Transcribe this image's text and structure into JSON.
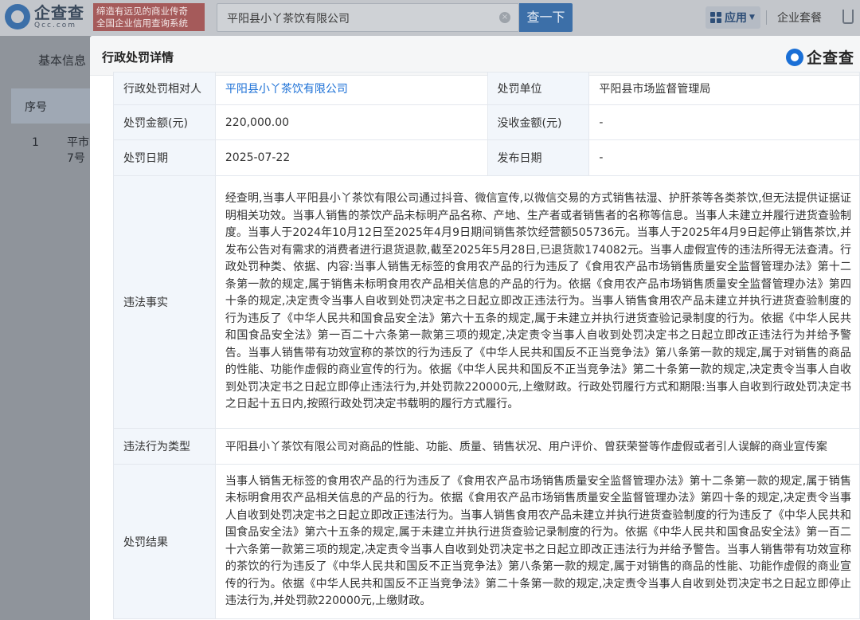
{
  "topbar": {
    "logo_cn": "企查查",
    "logo_en": "Qcc.com",
    "slogan_line1": "缔造有远见的商业传奇",
    "slogan_line2": "全国企业信用查询系统",
    "search_value": "平阳县小丫茶饮有限公司",
    "search_clear": "×",
    "search_button": "查一下",
    "apps_label": "应用",
    "suite_label": "企业套餐"
  },
  "background": {
    "tab_label": "基本信息",
    "table_header": "序号",
    "row_number": "1",
    "row_text_line1": "平市",
    "row_text_line2": "7号"
  },
  "modal": {
    "title": "行政处罚详情",
    "brand": "企查查",
    "rows": {
      "party_label": "行政处罚相对人",
      "party_value": "平阳县小丫茶饮有限公司",
      "unit_label": "处罚单位",
      "unit_value": "平阳县市场监督管理局",
      "amount_label": "处罚金额(元)",
      "amount_value": "220,000.00",
      "confiscated_label": "没收金额(元)",
      "confiscated_value": "-",
      "date_label": "处罚日期",
      "date_value": "2025-07-22",
      "publish_label": "发布日期",
      "publish_value": "-",
      "facts_label": "违法事实",
      "facts_value": "经查明,当事人平阳县小丫茶饮有限公司通过抖音、微信宣传,以微信交易的方式销售祛湿、护肝茶等各类茶饮,但无法提供证据证明相关功效。当事人销售的茶饮产品未标明产品名称、产地、生产者或者销售者的名称等信息。当事人未建立并履行进货查验制度。当事人于2024年10月12日至2025年4月9日期间销售茶饮经营额505736元。当事人于2025年4月9日起停止销售茶饮,并发布公告对有需求的消费者进行退货退款,截至2025年5月28日,已退货款174082元。当事人虚假宣传的违法所得无法查清。行政处罚种类、依据、内容:当事人销售无标签的食用农产品的行为违反了《食用农产品市场销售质量安全监督管理办法》第十二条第一款的规定,属于销售未标明食用农产品相关信息的产品的行为。依据《食用农产品市场销售质量安全监督管理办法》第四十条的规定,决定责令当事人自收到处罚决定书之日起立即改正违法行为。当事人销售食用农产品未建立并执行进货查验制度的行为违反了《中华人民共和国食品安全法》第六十五条的规定,属于未建立并执行进货查验记录制度的行为。依据《中华人民共和国食品安全法》第一百二十六条第一款第三项的规定,决定责令当事人自收到处罚决定书之日起立即改正违法行为并给予警告。当事人销售带有功效宣称的茶饮的行为违反了《中华人民共和国反不正当竞争法》第八条第一款的规定,属于对销售的商品的性能、功能作虚假的商业宣传的行为。依据《中华人民共和国反不正当竞争法》第二十条第一款的规定,决定责令当事人自收到处罚决定书之日起立即停止违法行为,并处罚款220000元,上缴财政。行政处罚履行方式和期限:当事人自收到行政处罚决定书之日起十五日内,按照行政处罚决定书载明的履行方式履行。",
      "type_label": "违法行为类型",
      "type_value": "平阳县小丫茶饮有限公司对商品的性能、功能、质量、销售状况、用户评价、曾获荣誉等作虚假或者引人误解的商业宣传案",
      "result_label": "处罚结果",
      "result_value": "当事人销售无标签的食用农产品的行为违反了《食用农产品市场销售质量安全监督管理办法》第十二条第一款的规定,属于销售未标明食用农产品相关信息的产品的行为。依据《食用农产品市场销售质量安全监督管理办法》第四十条的规定,决定责令当事人自收到处罚决定书之日起立即改正违法行为。当事人销售食用农产品未建立并执行进货查验制度的行为违反了《中华人民共和国食品安全法》第六十五条的规定,属于未建立并执行进货查验记录制度的行为。依据《中华人民共和国食品安全法》第一百二十六条第一款第三项的规定,决定责令当事人自收到处罚决定书之日起立即改正违法行为并给予警告。当事人销售带有功效宣称的茶饮的行为违反了《中华人民共和国反不正当竞争法》第八条第一款的规定,属于对销售的商品的性能、功能作虚假的商业宣传的行为。依据《中华人民共和国反不正当竞争法》第二十条第一款的规定,决定责令当事人自收到处罚决定书之日起立即停止违法行为,并处罚款220000元,上缴财政。"
    }
  }
}
